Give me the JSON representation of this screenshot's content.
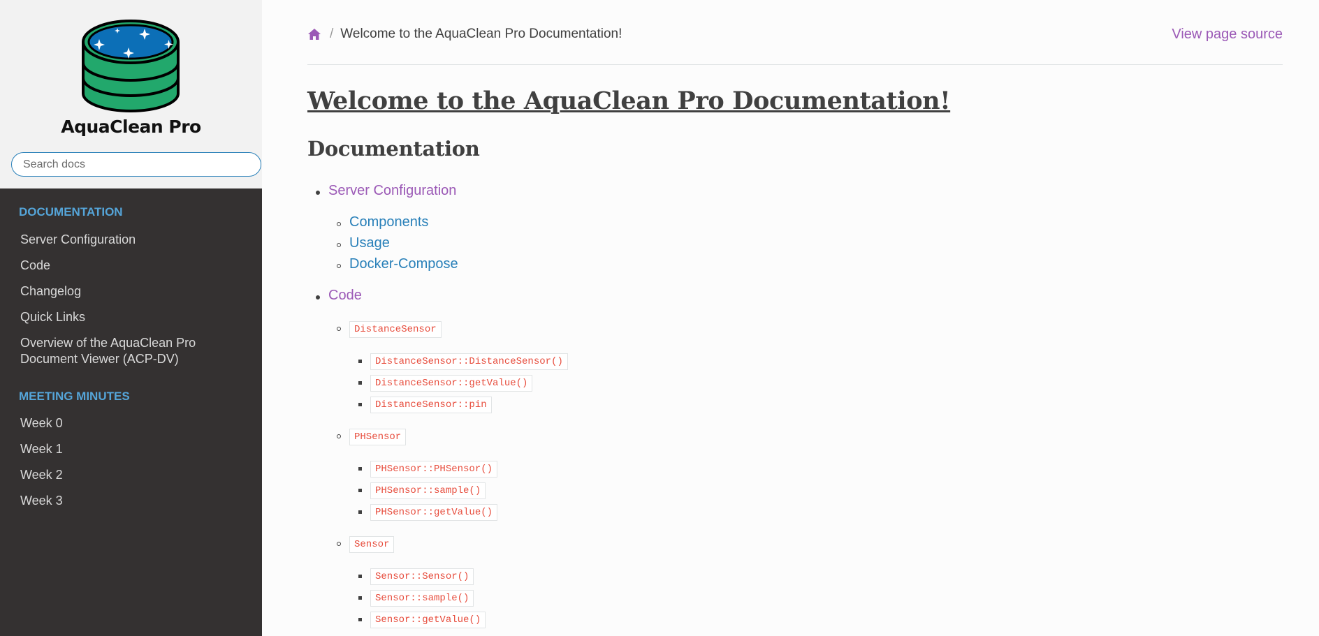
{
  "sidebar": {
    "brand": "AquaClean Pro",
    "search_placeholder": "Search docs",
    "sections": [
      {
        "caption": "DOCUMENTATION",
        "items": [
          "Server Configuration",
          "Code",
          "Changelog",
          "Quick Links",
          "Overview of the AquaClean Pro Document Viewer (ACP-DV)"
        ]
      },
      {
        "caption": "MEETING MINUTES",
        "items": [
          "Week 0",
          "Week 1",
          "Week 2",
          "Week 3"
        ]
      }
    ]
  },
  "header": {
    "home_icon": "home-icon",
    "separator": "/",
    "breadcrumb_current": "Welcome to the AquaClean Pro Documentation!",
    "view_source": "View page source"
  },
  "content": {
    "title": "Welcome to the AquaClean Pro Documentation!",
    "section": "Documentation",
    "toc": {
      "server_configuration": "Server Configuration",
      "server_children": [
        "Components",
        "Usage",
        "Docker-Compose"
      ],
      "code": "Code",
      "classes": [
        {
          "name": "DistanceSensor",
          "members": [
            "DistanceSensor::DistanceSensor()",
            "DistanceSensor::getValue()",
            "DistanceSensor::pin"
          ]
        },
        {
          "name": "PHSensor",
          "members": [
            "PHSensor::PHSensor()",
            "PHSensor::sample()",
            "PHSensor::getValue()"
          ]
        },
        {
          "name": "Sensor",
          "members": [
            "Sensor::Sensor()",
            "Sensor::sample()",
            "Sensor::getValue()"
          ]
        }
      ]
    }
  },
  "colors": {
    "sidebar_bg": "#343131",
    "caption": "#55a5d9",
    "link_visited": "#9b59b6",
    "link": "#2980b9",
    "code": "#e74c3c"
  }
}
